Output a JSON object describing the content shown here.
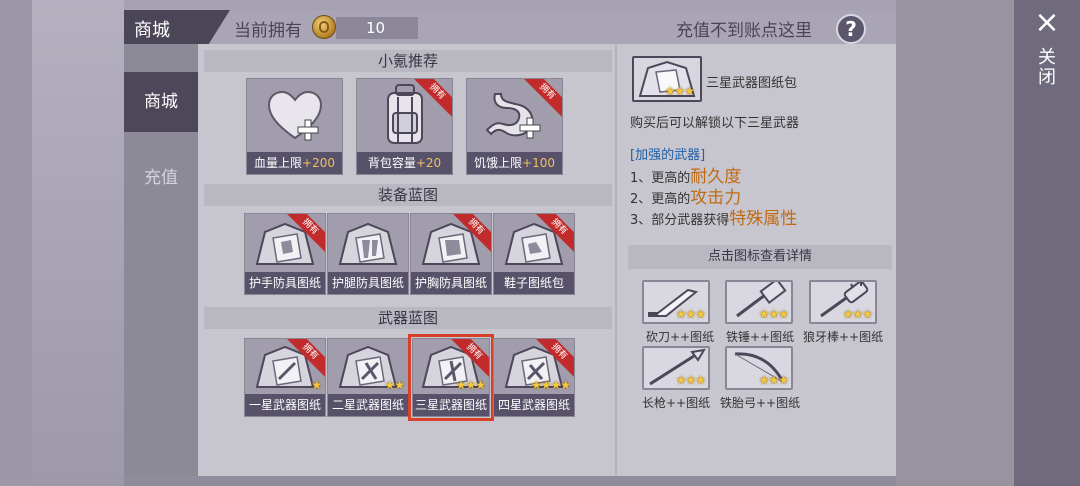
{
  "header": {
    "title": "商城",
    "owned_label": "当前拥有",
    "coin_value": "10",
    "recharge_help": "充值不到账点这里",
    "help_icon": "?"
  },
  "sidebar": {
    "items": [
      {
        "label": "商城",
        "active": true
      },
      {
        "label": "充值",
        "active": false
      }
    ]
  },
  "close": {
    "icon": "×",
    "label": "关闭"
  },
  "sections": {
    "recommend": {
      "title": "小氪推荐",
      "items": [
        {
          "label": "血量上限",
          "plus": "+200",
          "owned": false,
          "icon": "heart-plus-icon"
        },
        {
          "label": "背包容量",
          "plus": "+20",
          "owned": true,
          "icon": "backpack-icon"
        },
        {
          "label": "饥饿上限",
          "plus": "+100",
          "owned": true,
          "icon": "stomach-plus-icon"
        }
      ]
    },
    "equipment": {
      "title": "装备蓝图",
      "items": [
        {
          "label": "护手防具图纸",
          "owned": true
        },
        {
          "label": "护腿防具图纸",
          "owned": false
        },
        {
          "label": "护胸防具图纸",
          "owned": true
        },
        {
          "label": "鞋子图纸包",
          "owned": true
        }
      ]
    },
    "weapons": {
      "title": "武器蓝图",
      "items": [
        {
          "label": "一星武器图纸",
          "stars": 1,
          "owned": true
        },
        {
          "label": "二星武器图纸",
          "stars": 2,
          "owned": false
        },
        {
          "label": "三星武器图纸",
          "stars": 3,
          "owned": true,
          "selected": true
        },
        {
          "label": "四星武器图纸",
          "stars": 4,
          "owned": true
        }
      ]
    }
  },
  "badge_text": "拥有",
  "detail": {
    "name": "三星武器图纸包",
    "stars": 3,
    "desc": "购买后可以解锁以下三星武器",
    "enhanced_title": "[加强的武器]",
    "lines": [
      {
        "prefix": "1、更高的",
        "highlight": "耐久度"
      },
      {
        "prefix": "2、更高的",
        "highlight": "攻击力"
      },
      {
        "prefix": "3、部分武器获得",
        "highlight": "特殊属性"
      }
    ],
    "hint": "点击图标查看详情",
    "weapons": [
      {
        "label": "砍刀++图纸",
        "icon": "machete-icon"
      },
      {
        "label": "铁锤++图纸",
        "icon": "hammer-icon"
      },
      {
        "label": "狼牙棒++图纸",
        "icon": "spiked-club-icon"
      },
      {
        "label": "长枪++图纸",
        "icon": "spear-icon"
      },
      {
        "label": "铁胎弓++图纸",
        "icon": "bow-icon"
      }
    ]
  },
  "colors": {
    "accent_dark": "#4d4759",
    "badge_red": "#c22b2b",
    "star_gold": "#f7c83b",
    "highlight_orange": "#c06b12",
    "enhanced_blue": "#1e5fa8"
  }
}
